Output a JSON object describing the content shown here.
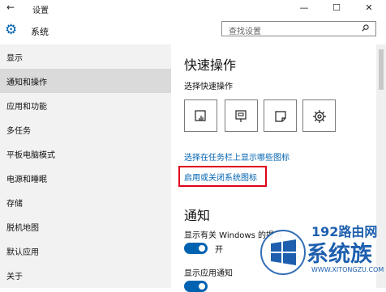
{
  "window": {
    "title": "设置",
    "back_glyph": "←",
    "min_glyph": "—",
    "max_glyph": "☐",
    "close_glyph": "✕"
  },
  "header": {
    "section_title": "系统",
    "search_placeholder": "查找设置"
  },
  "sidebar": {
    "items": [
      {
        "label": "显示",
        "active": false
      },
      {
        "label": "通知和操作",
        "active": true
      },
      {
        "label": "应用和功能",
        "active": false
      },
      {
        "label": "多任务",
        "active": false
      },
      {
        "label": "平板电脑模式",
        "active": false
      },
      {
        "label": "电源和睡眠",
        "active": false
      },
      {
        "label": "存储",
        "active": false
      },
      {
        "label": "脱机地图",
        "active": false
      },
      {
        "label": "默认应用",
        "active": false
      },
      {
        "label": "关于",
        "active": false
      }
    ]
  },
  "content": {
    "quick_actions_heading": "快速操作",
    "quick_actions_sub": "选择快速操作",
    "quick_action_tiles": [
      "tablet-mode-icon",
      "project-icon",
      "note-icon",
      "settings-icon"
    ],
    "link_taskbar_icons": "选择在任务栏上显示哪些图标",
    "link_system_icons": "启用或关闭系统图标",
    "notifications_heading": "通知",
    "setting_windows_tips": "显示有关 Windows 的提示",
    "toggle_windows_tips": "开",
    "setting_app_notifications": "显示应用通知"
  },
  "watermark": {
    "line1": "192路由网",
    "line2": "系统族",
    "line3": "WWW.XITONGZU.COM"
  },
  "colors": {
    "accent": "#0063b1",
    "highlight_box": "#e0001b",
    "sidebar_bg": "#f2f2f2",
    "sidebar_active": "#dadada"
  }
}
